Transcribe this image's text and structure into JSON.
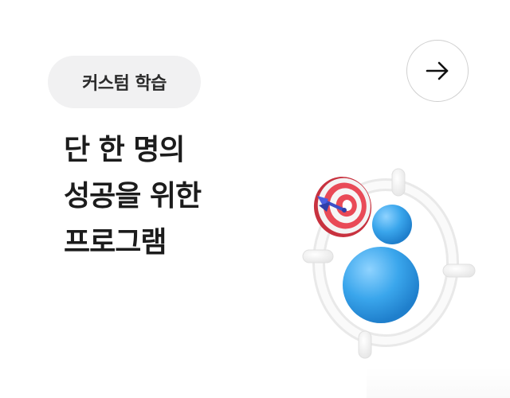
{
  "badge": {
    "label": "커스텀 학습"
  },
  "next_button": {
    "icon": "arrow-right-icon"
  },
  "headline": {
    "lines": [
      "단 한 명의",
      "성공을 위한",
      "프로그램"
    ]
  },
  "illustration": {
    "icon": "target-person-icon",
    "colors": {
      "person": "#3aa6ec",
      "target_red": "#e94a57",
      "dart": "#3c4fc8",
      "ring": "#f2f2f2"
    }
  }
}
